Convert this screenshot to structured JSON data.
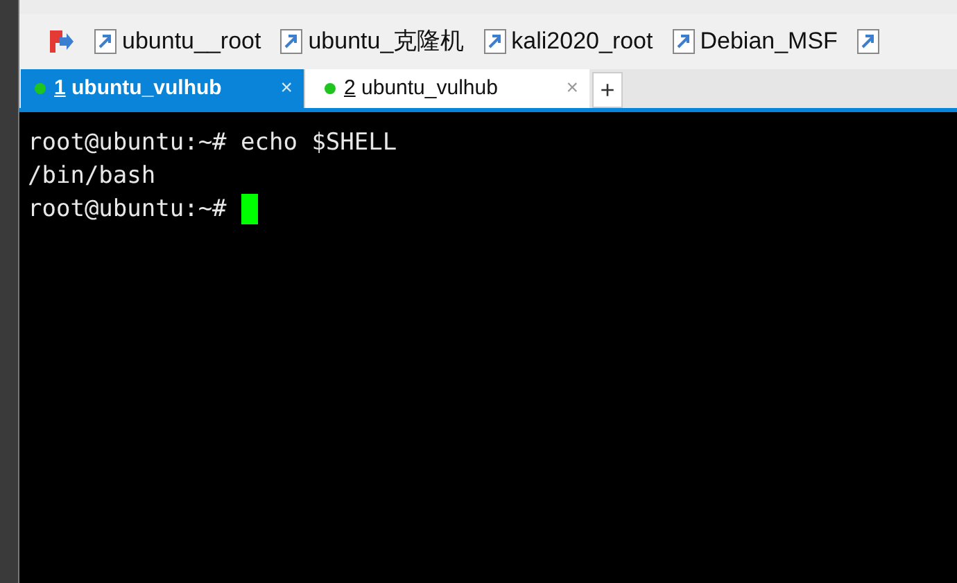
{
  "bookmarks": [
    {
      "label": "ubuntu__root",
      "kind": "session"
    },
    {
      "label": "ubuntu_克隆机",
      "kind": "session"
    },
    {
      "label": "kali2020_root",
      "kind": "session"
    },
    {
      "label": "Debian_MSF",
      "kind": "session"
    },
    {
      "kind": "session_cut"
    }
  ],
  "tabs": [
    {
      "number": "1",
      "label": "ubuntu_vulhub",
      "selected": true,
      "close": "×"
    },
    {
      "number": "2",
      "label": "ubuntu_vulhub",
      "selected": false,
      "close": "×"
    }
  ],
  "new_tab": "+",
  "terminal": {
    "lines": [
      "root@ubuntu:~# echo $SHELL",
      "/bin/bash",
      "root@ubuntu:~# "
    ],
    "cursor": true
  }
}
